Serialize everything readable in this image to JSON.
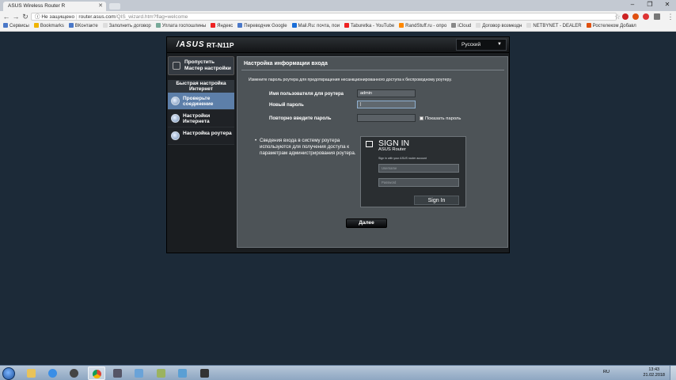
{
  "browser": {
    "tab_title": "ASUS Wireless Router R",
    "address": {
      "security_label": "Не защищено",
      "host": "router.asus.com",
      "path": "/QIS_wizard.htm?flag=welcome"
    },
    "bookmarks": [
      "Сервисы",
      "Bookmarks",
      "ВКонтакте",
      "Заполнить договор",
      "Уплата госпошлины",
      "Яндекс",
      "Переводчик Google",
      "Mail.Ru: почта, пои",
      "Taburetka - YouTube",
      "RandStuff.ru - опро",
      "iCloud",
      "Договор возмездн",
      "NETBYNET - DEALER",
      "Ростелеком Добавл"
    ]
  },
  "router": {
    "logo": "/ASUS",
    "model": "RT-N11P",
    "language": "Русский",
    "sidebar": {
      "skip_label": "Пропустить Мастер настройки",
      "quick_setup_label": "Быстрая настройка Интернет",
      "steps": [
        {
          "label": "Проверьте соединение",
          "state": "active"
        },
        {
          "label": "Настройки Интернета",
          "state": "inactive"
        },
        {
          "label": "Настройка роутера",
          "state": "inactive"
        }
      ]
    },
    "panel": {
      "title": "Настройка информации входа",
      "description": "Измените пароль роутера для предотвращения несанкционированного доступа к беспроводному роутеру.",
      "fields": {
        "username_label": "Имя пользователя для роутера",
        "username_value": "admin",
        "password_label": "Новый пароль",
        "password_value": "|",
        "confirm_label": "Повторно введите пароль",
        "confirm_value": ""
      },
      "show_password_label": "Показать пароль",
      "show_password_checked": false,
      "info_text": "Сведения входа в систему роутера используются для получения доступа к параметрам администрирования роутера.",
      "signin_preview": {
        "title": "SIGN IN",
        "subtitle": "ASUS Router",
        "description": "Sign in with your ASUS router account",
        "username_placeholder": "Username",
        "password_placeholder": "Password",
        "button_label": "Sign In"
      },
      "next_label": "Далее"
    }
  },
  "taskbar": {
    "tray_language": "RU",
    "clock_time": "13:43",
    "clock_date": "21.02.2018"
  },
  "colors": {
    "page_background": "#1c2a38",
    "panel_background": "#4d5357",
    "active_step": "#5d7fa9"
  }
}
